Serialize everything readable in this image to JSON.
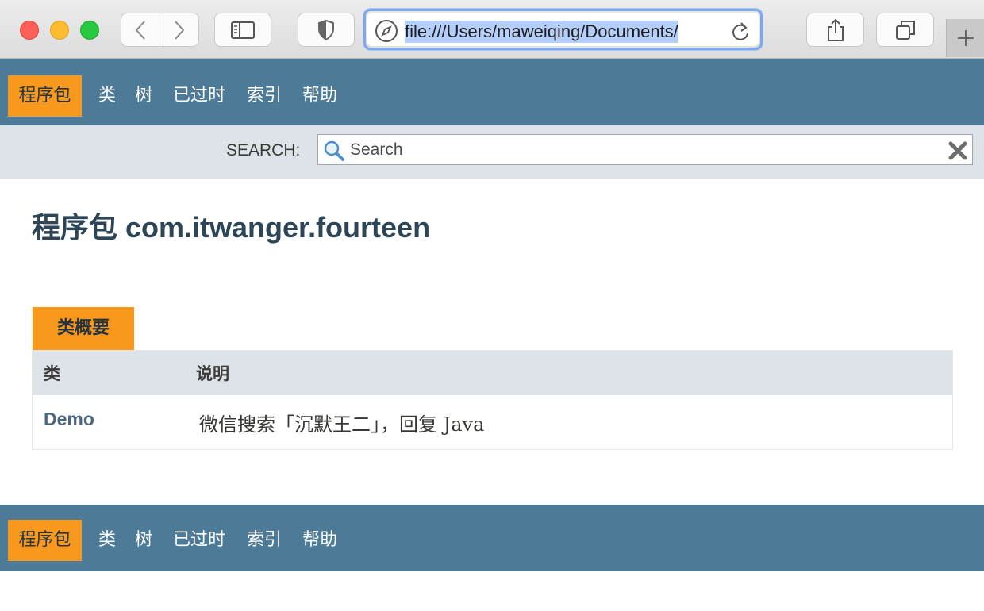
{
  "browser": {
    "url": "file:///Users/maweiqing/Documents/",
    "colors": {
      "url_selection": "#b4cffb",
      "url_focus_ring": "#7ea8ea"
    },
    "icons": [
      "back-chevron-icon",
      "forward-chevron-icon",
      "sidebar-icon",
      "shield-icon",
      "compass-icon",
      "reload-icon",
      "share-icon",
      "tabs-icon",
      "plus-icon"
    ]
  },
  "navbar": {
    "items": [
      {
        "label": "程序包",
        "active": true
      },
      {
        "label": "类"
      },
      {
        "label": "树"
      },
      {
        "label": "已过时"
      },
      {
        "label": "索引"
      },
      {
        "label": "帮助"
      }
    ],
    "colors": {
      "background": "#4d7a97",
      "active": "#f8981d"
    }
  },
  "search": {
    "label": "SEARCH:",
    "placeholder": "Search"
  },
  "page": {
    "title": "程序包 com.itwanger.fourteen"
  },
  "summary": {
    "caption": "类概要",
    "headers": [
      "类",
      "说明"
    ],
    "rows": [
      {
        "name": "Demo",
        "description": "微信搜索「沉默王二」，回复 Java"
      }
    ]
  },
  "bottom_navbar": {
    "items": [
      {
        "label": "程序包",
        "active": true
      },
      {
        "label": "类"
      },
      {
        "label": "树"
      },
      {
        "label": "已过时"
      },
      {
        "label": "索引"
      },
      {
        "label": "帮助"
      }
    ]
  }
}
